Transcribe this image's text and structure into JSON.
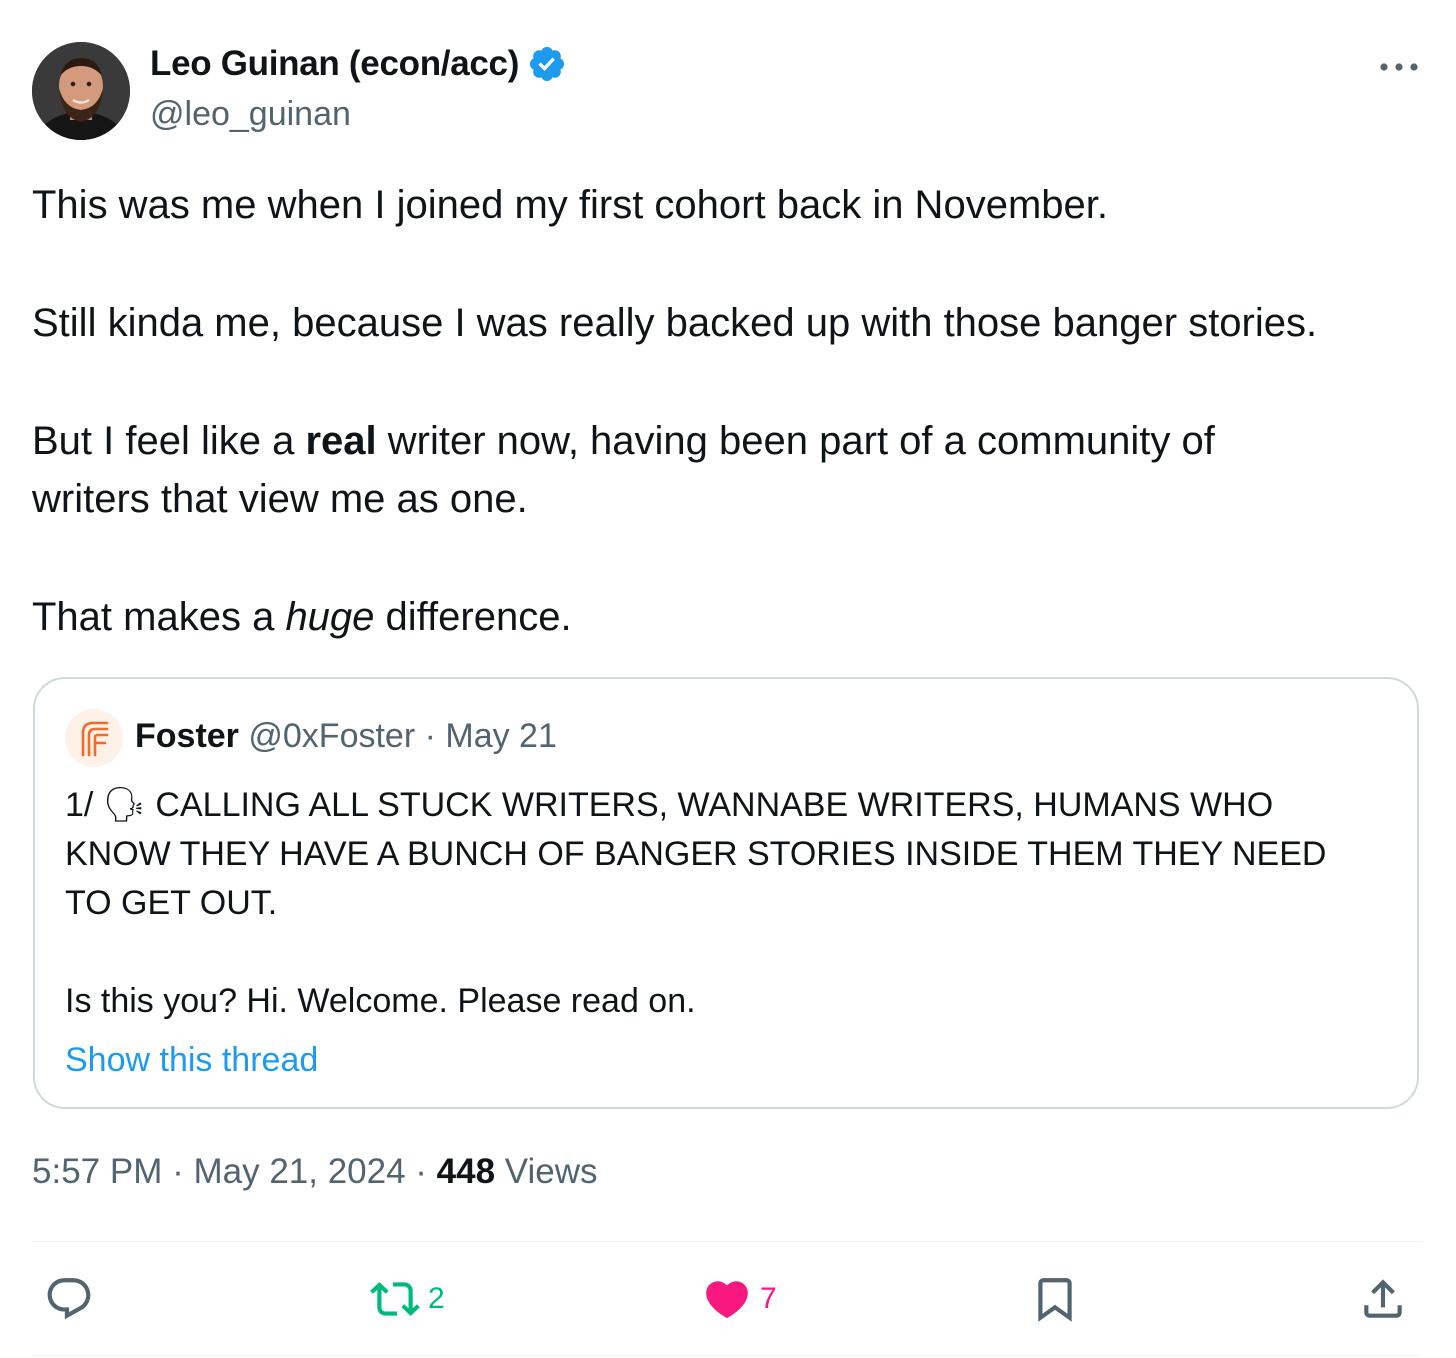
{
  "author": {
    "name": "Leo Guinan (econ/acc)",
    "handle": "@leo_guinan",
    "verified_color": "#1d9bf0"
  },
  "more_icon": "more-dots-icon",
  "tweet": {
    "p1": "This was me when I joined my first cohort back in November.",
    "p2": "Still kinda me, because I was really backed up with those banger stories.",
    "p3_before": "But I feel like a ",
    "p3_bold": "real",
    "p3_after": " writer now, having been part of a community of",
    "p3_line2": "writers that view me as one.",
    "p4_before": "That makes a ",
    "p4_italic": "huge",
    "p4_after": " difference."
  },
  "quote": {
    "name": "Foster",
    "handle": "@0xFoster",
    "separator": " · ",
    "date": "May 21",
    "line1_prefix": "1/ ",
    "emoji": "🗣",
    "line1": " CALLING ALL STUCK WRITERS, WANNABE WRITERS, HUMANS WHO",
    "line2": "KNOW THEY HAVE A BUNCH OF BANGER STORIES INSIDE THEM THEY NEED",
    "line3": "TO GET OUT.",
    "line4": "Is this you? Hi. Welcome. Please read on.",
    "show_thread": "Show this thread",
    "avatar_color": "#f26b2a"
  },
  "meta": {
    "time": "5:57 PM",
    "sep": " · ",
    "date": "May 21, 2024",
    "views_count": "448",
    "views_label": " Views"
  },
  "actions": {
    "retweets": "2",
    "likes": "7",
    "retweet_color": "#00ba7c",
    "like_color": "#f91880",
    "icon_color": "#536471"
  }
}
